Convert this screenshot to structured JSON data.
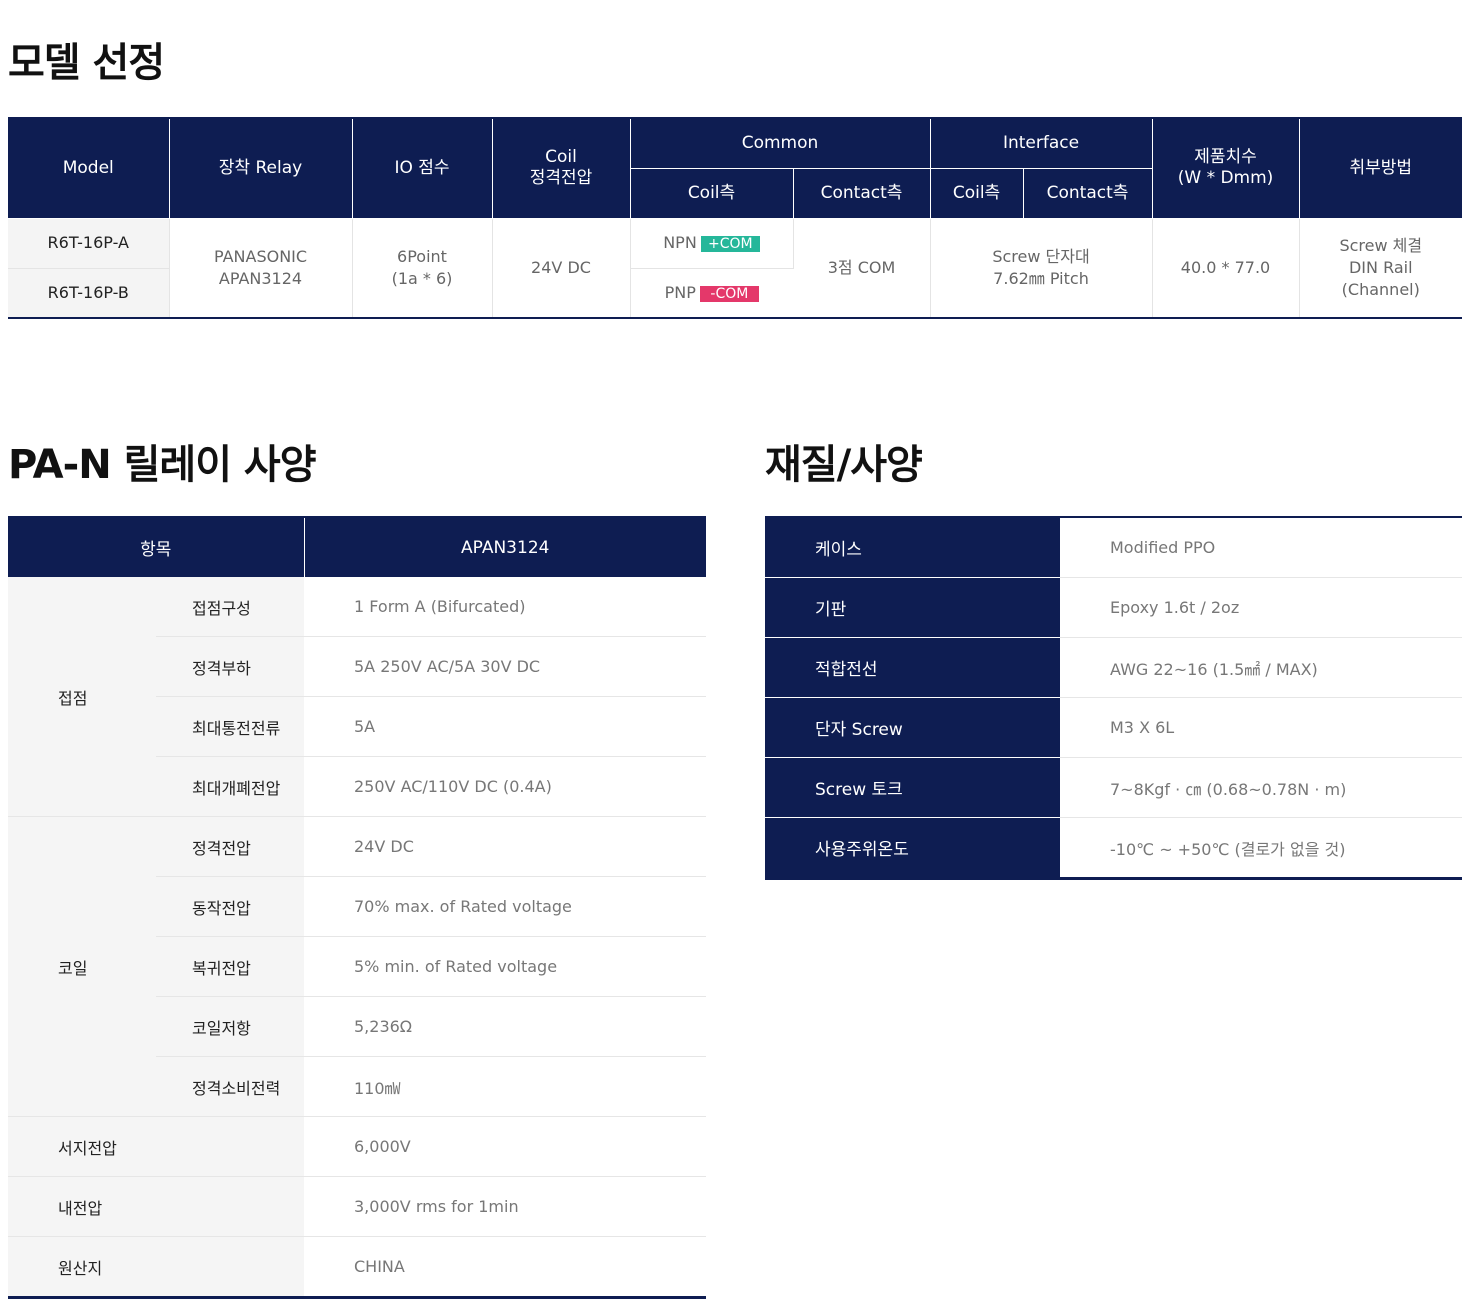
{
  "model_section": {
    "title": "모델 선정",
    "headers": {
      "model": "Model",
      "relay": "장착 Relay",
      "io": "IO 점수",
      "coil_line1": "Coil",
      "coil_line2": "정격전압",
      "common": "Common",
      "interface": "Interface",
      "size_line1": "제품치수",
      "size_line2": "(W * Dmm)",
      "mount": "취부방법",
      "common_coil": "Coil측",
      "common_contact": "Contact측",
      "interface_coil": "Coil측",
      "interface_contact": "Contact측"
    },
    "rows": [
      {
        "model": "R6T-16P-A",
        "coil_prefix": "NPN",
        "coil_tag": "+COM"
      },
      {
        "model": "R6T-16P-B",
        "coil_prefix": "PNP",
        "coil_tag": "-COM"
      }
    ],
    "shared": {
      "relay_line1": "PANASONIC",
      "relay_line2": "APAN3124",
      "io_line1": "6Point",
      "io_line2": "(1a * 6)",
      "coil_voltage": "24V DC",
      "common_contact": "3점 COM",
      "interface_line1": "Screw 단자대",
      "interface_line2": "7.62㎜ Pitch",
      "size": "40.0 * 77.0",
      "mount_line1": "Screw 체결",
      "mount_line2": "DIN Rail",
      "mount_line3": "(Channel)"
    },
    "colors": {
      "header_bg": "#0e1d52",
      "plus_com": "#25b79a",
      "minus_com": "#e4386a"
    }
  },
  "relay_spec": {
    "title": "PA-N 릴레이 사양",
    "header_item": "항목",
    "header_value": "APAN3124",
    "groups": [
      {
        "name": "접점",
        "rows": [
          {
            "label": "접점구성",
            "value": "1 Form A (Bifurcated)"
          },
          {
            "label": "정격부하",
            "value": "5A 250V AC/5A 30V DC"
          },
          {
            "label": "최대통전전류",
            "value": "5A"
          },
          {
            "label": "최대개폐전압",
            "value": "250V AC/110V DC (0.4A)"
          }
        ]
      },
      {
        "name": "코일",
        "rows": [
          {
            "label": "정격전압",
            "value": "24V DC"
          },
          {
            "label": "동작전압",
            "value": "70% max. of Rated voltage"
          },
          {
            "label": "복귀전압",
            "value": "5% min. of Rated voltage"
          },
          {
            "label": "코일저항",
            "value": "5,236Ω"
          },
          {
            "label": "정격소비전력",
            "value": "110㎽"
          }
        ]
      }
    ],
    "singles": [
      {
        "label": "서지전압",
        "value": "6,000V"
      },
      {
        "label": "내전압",
        "value": "3,000V rms for 1min"
      },
      {
        "label": "원산지",
        "value": "CHINA"
      }
    ]
  },
  "material_spec": {
    "title": "재질/사양",
    "rows": [
      {
        "label": "케이스",
        "value": "Modified PPO"
      },
      {
        "label": "기판",
        "value": "Epoxy 1.6t / 2oz"
      },
      {
        "label": "적합전선",
        "value": "AWG 22~16 (1.5㎟ / MAX)"
      },
      {
        "label": "단자 Screw",
        "value": "M3 X 6L"
      },
      {
        "label": "Screw 토크",
        "value": "7~8Kgf · ㎝ (0.68~0.78N · m)"
      },
      {
        "label": "사용주위온도",
        "value": "-10℃ ~ +50℃ (결로가 없을 것)"
      }
    ]
  }
}
